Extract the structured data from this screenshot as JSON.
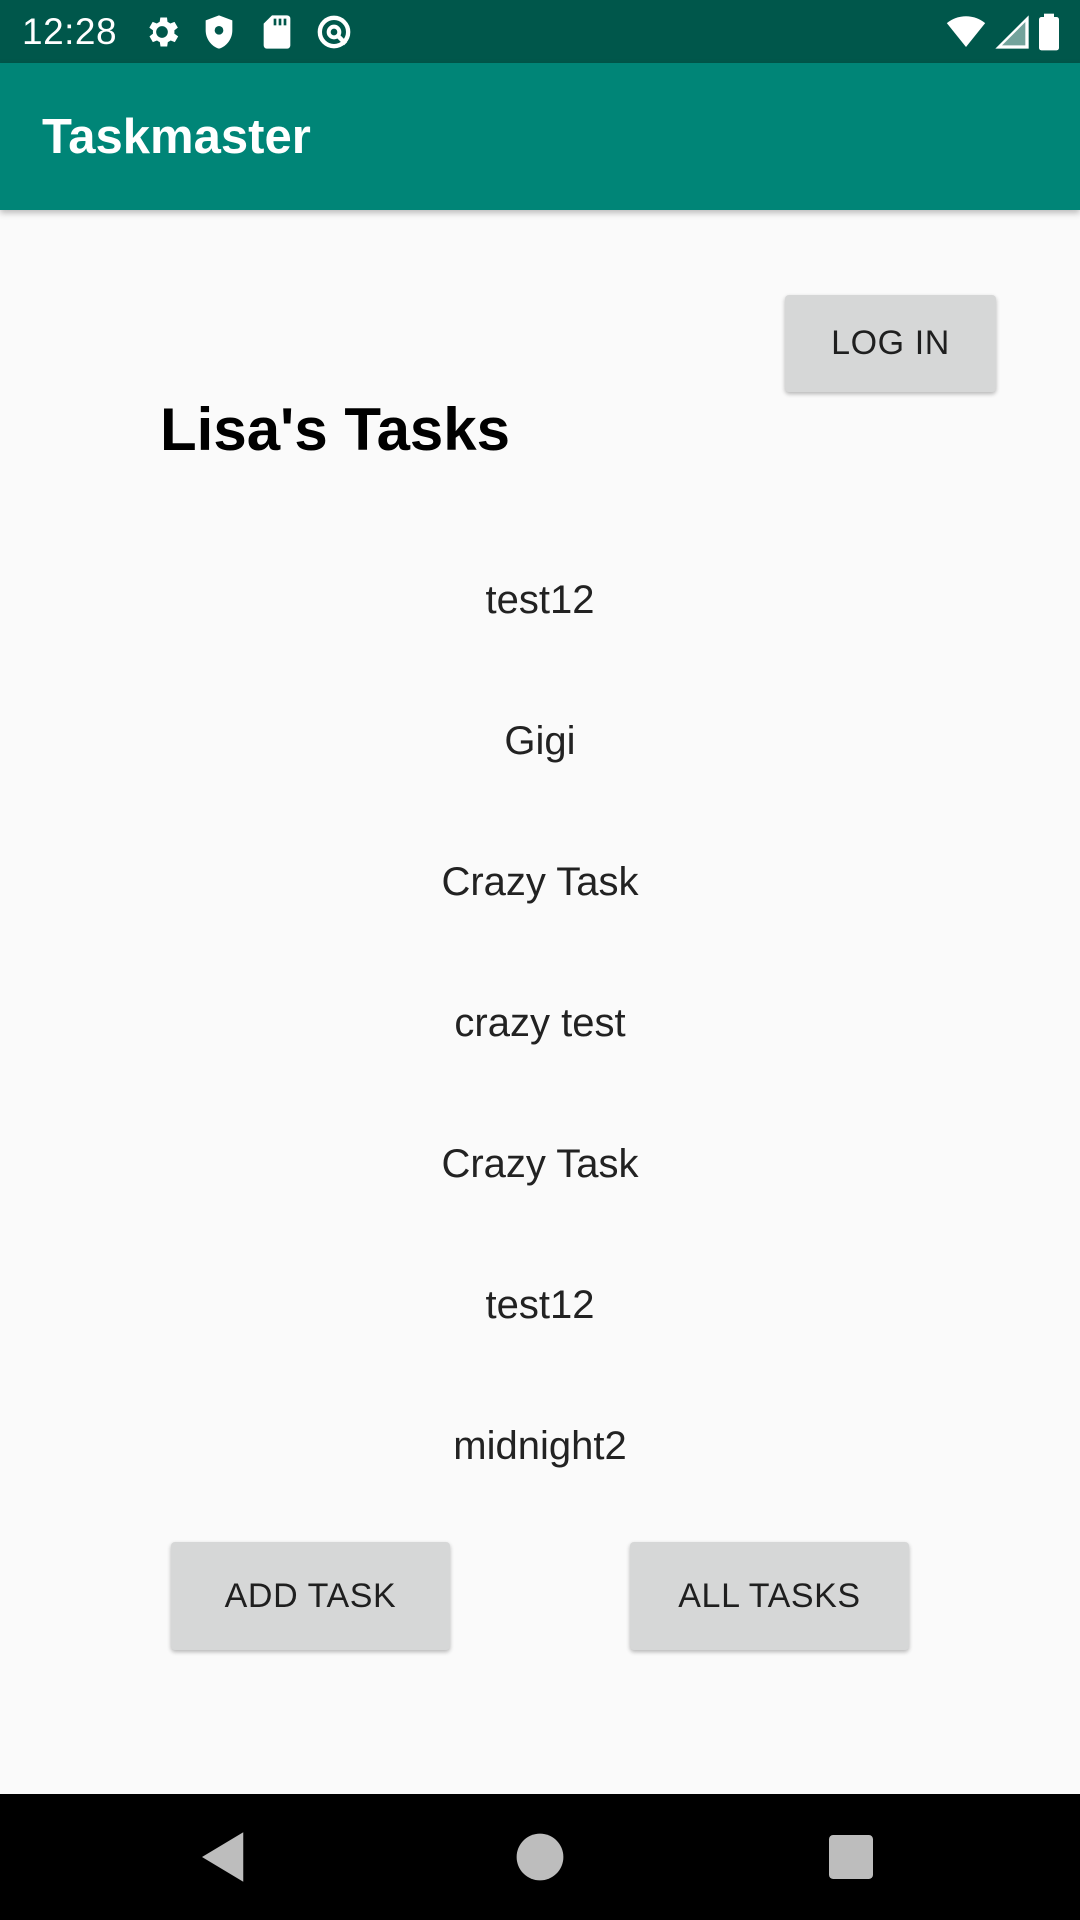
{
  "status_bar": {
    "time": "12:28",
    "icons": [
      "gear-icon",
      "shield-icon",
      "sd-card-icon",
      "data-saver-icon",
      "wifi-icon",
      "cell-signal-icon",
      "battery-icon"
    ]
  },
  "app_bar": {
    "title": "Taskmaster",
    "color": "#008577"
  },
  "header": {
    "login_label": "LOG IN",
    "title": "Lisa's Tasks"
  },
  "tasks": [
    {
      "label": "test12"
    },
    {
      "label": "Gigi"
    },
    {
      "label": "Crazy Task"
    },
    {
      "label": "crazy test"
    },
    {
      "label": "Crazy Task"
    },
    {
      "label": "test12"
    },
    {
      "label": "midnight2"
    }
  ],
  "footer": {
    "add_task_label": "ADD TASK",
    "all_tasks_label": "ALL TASKS"
  },
  "nav_bar": {
    "icons": [
      "back-icon",
      "home-icon",
      "recents-icon"
    ]
  },
  "colors": {
    "status_bar": "#00574b",
    "app_bar": "#008577",
    "button": "#d6d7d7",
    "background": "#fafafa"
  }
}
